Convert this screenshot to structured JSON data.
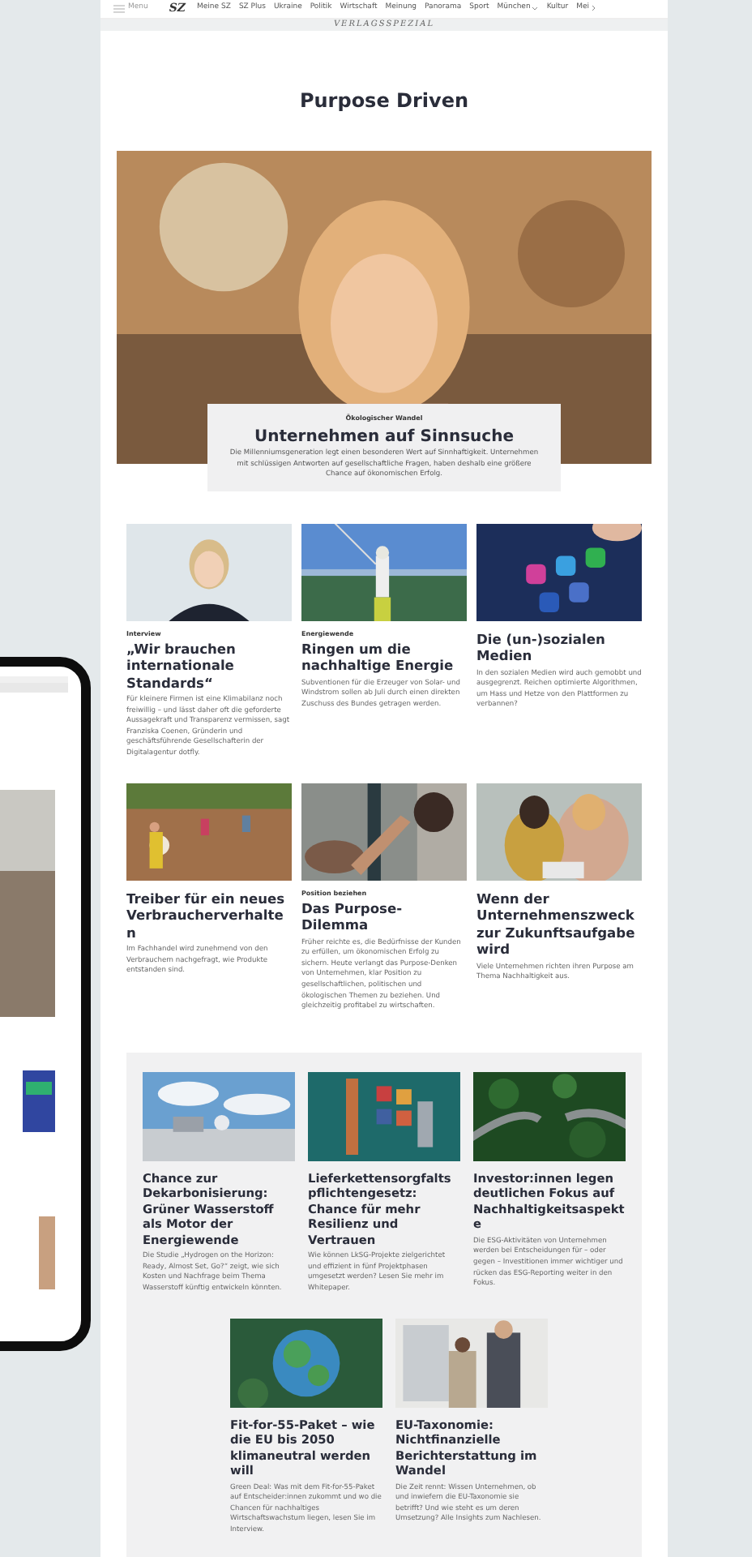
{
  "nav": {
    "menu_label": "Menu",
    "logo": "SZ",
    "items": [
      {
        "label": "Meine SZ",
        "dropdown": false
      },
      {
        "label": "SZ Plus",
        "dropdown": false
      },
      {
        "label": "Ukraine",
        "dropdown": false
      },
      {
        "label": "Politik",
        "dropdown": false
      },
      {
        "label": "Wirtschaft",
        "dropdown": false
      },
      {
        "label": "Meinung",
        "dropdown": false
      },
      {
        "label": "Panorama",
        "dropdown": false
      },
      {
        "label": "Sport",
        "dropdown": false
      },
      {
        "label": "München",
        "dropdown": true
      },
      {
        "label": "Kultur",
        "dropdown": false
      },
      {
        "label": "Mei",
        "more": true
      }
    ]
  },
  "banner": "VERLAGSSPEZIAL",
  "page_title": "Purpose Driven",
  "hero": {
    "kicker": "Ökologischer Wandel",
    "title": "Unternehmen auf Sinnsuche",
    "text": "Die Millenniumsgeneration legt einen besonderen Wert auf Sinnhaftigkeit. Unternehmen mit schlüssigen Antworten auf gesellschaftliche Fragen, haben deshalb eine größere Chance auf ökonomischen Erfolg."
  },
  "articles": [
    {
      "kicker": "Interview",
      "title": "„Wir brauchen internationale Standards“",
      "text": "Für kleinere Firmen ist eine Klimabilanz noch freiwillig – und lässt daher oft die geforderte Aussagekraft und Transparenz vermissen, sagt Franziska Coenen, Gründerin und geschäftsführende Gesellschafterin der Digitalagentur dotfly."
    },
    {
      "kicker": "Energiewende",
      "title": "Ringen um die nachhaltige Energie",
      "text": "Subventionen für die Erzeuger von Solar- und Windstrom sollen ab Juli durch einen direkten Zuschuss des Bundes getragen werden."
    },
    {
      "title": "Die (un-)sozialen Medien",
      "text": "In den sozialen Medien wird auch gemobbt und ausgegrenzt. Reichen optimierte Algorithmen, um Hass und Hetze von den Plattformen zu verbannen?"
    },
    {
      "title": "Treiber für ein neues Verbraucherverhalten",
      "text": "Im Fachhandel wird zunehmend von den Verbrauchern nachgefragt, wie Produkte entstanden sind."
    },
    {
      "kicker": "Position beziehen",
      "title": "Das Purpose-Dilemma",
      "text": "Früher reichte es, die Bedürfnisse der Kunden zu erfüllen, um ökonomischen Erfolg zu sichern. Heute verlangt das Purpose-Denken von Unternehmen, klar Position zu gesellschaftlichen, politischen und ökologischen Themen zu beziehen. Und gleichzeitig profitabel zu wirtschaften."
    },
    {
      "title": "Wenn der Unternehmenszweck zur Zukunftsaufgabe wird",
      "text": "Viele Unternehmen richten ihren Purpose am Thema Nachhaltigkeit aus."
    }
  ],
  "featured": [
    {
      "title": "Chance zur Dekarbonisierung: Grüner Wasserstoff als Motor der Energiewende",
      "text": "Die Studie „Hydrogen on the Horizon: Ready, Almost Set, Go?“ zeigt, wie sich Kosten und Nachfrage beim Thema Wasserstoff künftig entwickeln könnten."
    },
    {
      "title": "Lieferkettensorgfalts pflichtengesetz: Chance für mehr Resilienz und Vertrauen",
      "text": "Wie können LkSG-Projekte zielgerichtet und effizient in fünf Projektphasen umgesetzt werden? Lesen Sie mehr im Whitepaper."
    },
    {
      "title": "Investor:innen legen deutlichen Fokus auf Nachhaltigkeitsaspekte",
      "text": "Die ESG-Aktivitäten von Unternehmen werden bei Entscheidungen für – oder gegen – Investitionen immer wichtiger und rücken das ESG-Reporting weiter in den Fokus."
    },
    {
      "title": "Fit-for-55-Paket – wie die EU bis 2050 klimaneutral werden will",
      "text": "Green Deal: Was mit dem Fit-for-55-Paket auf Entscheider:innen zukommt und wo die Chancen für nachhaltiges Wirtschaftswachstum liegen, lesen Sie im Interview."
    },
    {
      "title": "EU-Taxonomie: Nichtfinanzielle Berichterstattung im Wandel",
      "text": "Die Zeit rennt: Wissen Unternehmen, ob und inwiefern die EU-Taxonomie sie betrifft? Und wie steht es um deren Umsetzung? Alle Insights zum Nachlesen."
    }
  ]
}
